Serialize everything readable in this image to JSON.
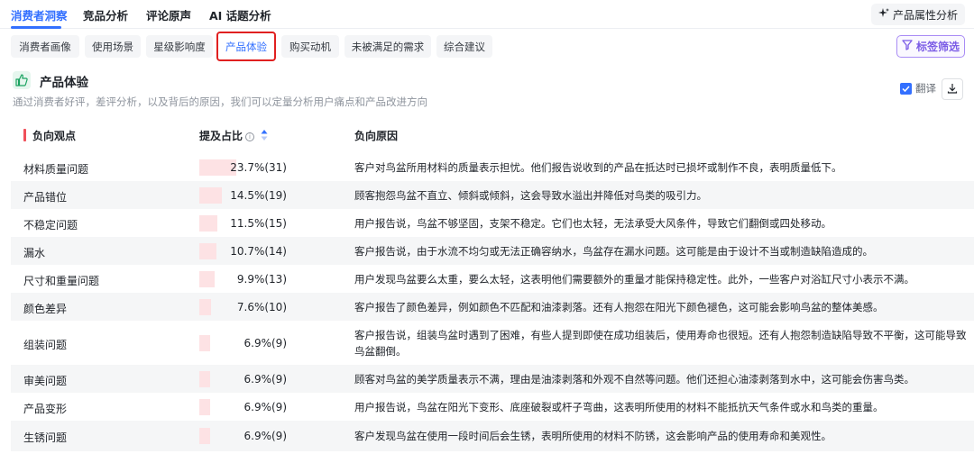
{
  "top_tabs": [
    {
      "label": "消费者洞察",
      "active": true
    },
    {
      "label": "竞品分析",
      "active": false
    },
    {
      "label": "评论原声",
      "active": false
    },
    {
      "label": "AI 话题分析",
      "active": false
    }
  ],
  "attribute_button": {
    "label": "产品属性分析",
    "icon": "sparkle-icon"
  },
  "sub_tabs": [
    {
      "label": "消费者画像"
    },
    {
      "label": "使用场景"
    },
    {
      "label": "星级影响度"
    },
    {
      "label": "产品体验",
      "active": true
    },
    {
      "label": "购买动机"
    },
    {
      "label": "未被满足的需求"
    },
    {
      "label": "综合建议"
    }
  ],
  "filter_button": {
    "label": "标签筛选",
    "icon": "filter-icon"
  },
  "section": {
    "icon": "thumbs-up-icon",
    "title": "产品体验",
    "description": "通过消费者好评，差评分析，以及背后的原因，我们可以定量分析用户痛点和产品改进方向",
    "translate_label": "翻译",
    "translate_checked": true
  },
  "table": {
    "headers": {
      "opinion": "负向观点",
      "ratio": "提及占比",
      "reason": "负向原因"
    },
    "rows": [
      {
        "name": "材料质量问题",
        "pct": 23.7,
        "ratio": "23.7%(31)",
        "reason": "客户对鸟盆所用材料的质量表示担忧。他们报告说收到的产品在抵达时已损坏或制作不良，表明质量低下。"
      },
      {
        "name": "产品错位",
        "pct": 14.5,
        "ratio": "14.5%(19)",
        "reason": "顾客抱怨鸟盆不直立、倾斜或倾斜，这会导致水溢出并降低对鸟类的吸引力。"
      },
      {
        "name": "不稳定问题",
        "pct": 11.5,
        "ratio": "11.5%(15)",
        "reason": "用户报告说，鸟盆不够坚固，支架不稳定。它们也太轻，无法承受大风条件，导致它们翻倒或四处移动。"
      },
      {
        "name": "漏水",
        "pct": 10.7,
        "ratio": "10.7%(14)",
        "reason": "客户报告说，由于水流不均匀或无法正确容纳水，鸟盆存在漏水问题。这可能是由于设计不当或制造缺陷造成的。"
      },
      {
        "name": "尺寸和重量问题",
        "pct": 9.9,
        "ratio": "9.9%(13)",
        "reason": "用户发现鸟盆要么太重，要么太轻，这表明他们需要额外的重量才能保持稳定性。此外，一些客户对浴缸尺寸小表示不满。"
      },
      {
        "name": "颜色差异",
        "pct": 7.6,
        "ratio": "7.6%(10)",
        "reason": "客户报告了颜色差异，例如颜色不匹配和油漆剥落。还有人抱怨在阳光下颜色褪色，这可能会影响鸟盆的整体美感。"
      },
      {
        "name": "组装问题",
        "pct": 6.9,
        "ratio": "6.9%(9)",
        "reason": "客户报告说，组装鸟盆时遇到了困难，有些人提到即使在成功组装后，使用寿命也很短。还有人抱怨制造缺陷导致不平衡，这可能导致鸟盆翻倒。"
      },
      {
        "name": "审美问题",
        "pct": 6.9,
        "ratio": "6.9%(9)",
        "reason": "顾客对鸟盆的美学质量表示不满，理由是油漆剥落和外观不自然等问题。他们还担心油漆剥落到水中，这可能会伤害鸟类。"
      },
      {
        "name": "产品变形",
        "pct": 6.9,
        "ratio": "6.9%(9)",
        "reason": "用户报告说，鸟盆在阳光下变形、底座破裂或杆子弯曲，这表明所使用的材料不能抵抗天气条件或水和鸟类的重量。"
      },
      {
        "name": "生锈问题",
        "pct": 6.9,
        "ratio": "6.9%(9)",
        "reason": "客户发现鸟盆在使用一段时间后会生锈，表明所使用的材料不防锈，这会影响产品的使用寿命和美观性。"
      }
    ]
  }
}
